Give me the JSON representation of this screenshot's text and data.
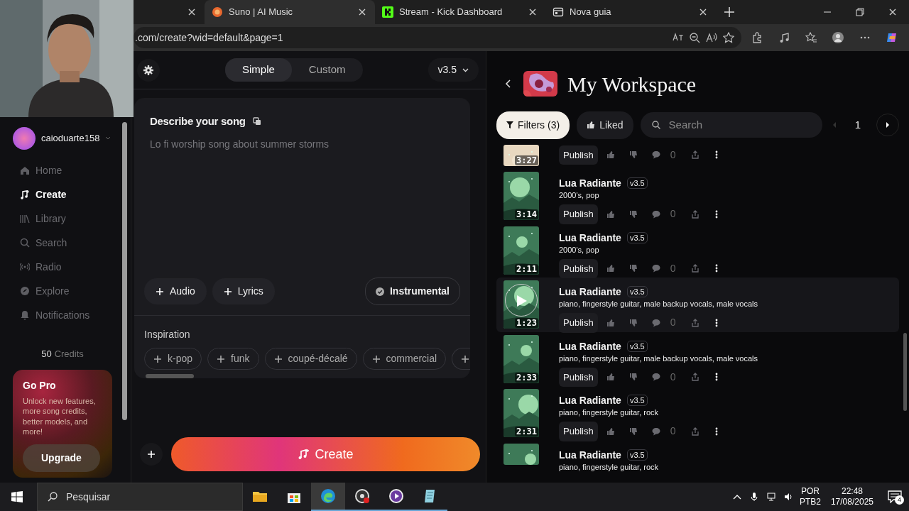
{
  "browser": {
    "tabs": [
      {
        "selected": false
      },
      {
        "title": "Suno | AI Music",
        "selected": true
      },
      {
        "title": "Stream - Kick Dashboard",
        "selected": false
      },
      {
        "title": "Nova guia",
        "selected": false
      }
    ],
    "url": ".com/create?wid=default&page=1"
  },
  "sidebar": {
    "user": "caioduarte158",
    "items": [
      {
        "label": "Home",
        "selected": false
      },
      {
        "label": "Create",
        "selected": true
      },
      {
        "label": "Library",
        "selected": false
      },
      {
        "label": "Search",
        "selected": false
      },
      {
        "label": "Radio",
        "selected": false
      },
      {
        "label": "Explore",
        "selected": false
      },
      {
        "label": "Notifications",
        "selected": false
      }
    ],
    "credits_count": "50",
    "credits_label": "Credits",
    "promo": {
      "title": "Go Pro",
      "text": "Unlock new features, more song credits, better models, and more!",
      "button": "Upgrade"
    }
  },
  "create": {
    "modes": [
      {
        "label": "Simple",
        "selected": true
      },
      {
        "label": "Custom",
        "selected": false
      }
    ],
    "version": "v3.5",
    "describe_label": "Describe your song",
    "placeholder": "Lo fi worship song about summer storms",
    "add_buttons": [
      "Audio",
      "Lyrics"
    ],
    "instrumental": {
      "label": "Instrumental",
      "on": false
    },
    "inspiration_label": "Inspiration",
    "chips": [
      {
        "label": "k-pop"
      },
      {
        "label": "funk"
      },
      {
        "label": "coupé-décalé"
      },
      {
        "label": "commercial"
      }
    ],
    "chips_cut_off": true,
    "create_button": "Create"
  },
  "workspace": {
    "title": "My Workspace",
    "filters": "Filters (3)",
    "liked": "Liked",
    "search_placeholder": "Search",
    "page": "1",
    "songs": [
      {
        "duration": "3:27",
        "publish": "Publish",
        "comments": "0",
        "hovered": false
      },
      {
        "title": "Lua Radiante",
        "version": "v3.5",
        "tags": "2000's, pop",
        "duration": "3:14",
        "publish": "Publish",
        "comments": "0",
        "hovered": false
      },
      {
        "title": "Lua Radiante",
        "version": "v3.5",
        "tags": "2000's, pop",
        "duration": "2:11",
        "publish": "Publish",
        "comments": "0",
        "hovered": false
      },
      {
        "title": "Lua Radiante",
        "version": "v3.5",
        "tags": "piano, fingerstyle guitar, male backup vocals, male vocals",
        "duration": "1:23",
        "publish": "Publish",
        "comments": "0",
        "hovered": true
      },
      {
        "title": "Lua Radiante",
        "version": "v3.5",
        "tags": "piano, fingerstyle guitar, male backup vocals, male vocals",
        "duration": "2:33",
        "publish": "Publish",
        "comments": "0",
        "hovered": false
      },
      {
        "title": "Lua Radiante",
        "version": "v3.5",
        "tags": "piano, fingerstyle guitar, rock",
        "duration": "2:31",
        "publish": "Publish",
        "comments": "0",
        "hovered": false
      },
      {
        "title": "Lua Radiante",
        "version": "v3.5",
        "tags": "piano, fingerstyle guitar, rock"
      }
    ]
  },
  "taskbar": {
    "search_placeholder": "Pesquisar",
    "lang": "POR",
    "layout": "PTB2",
    "time": "22:48",
    "date": "17/08/2025",
    "notifications": "4"
  }
}
